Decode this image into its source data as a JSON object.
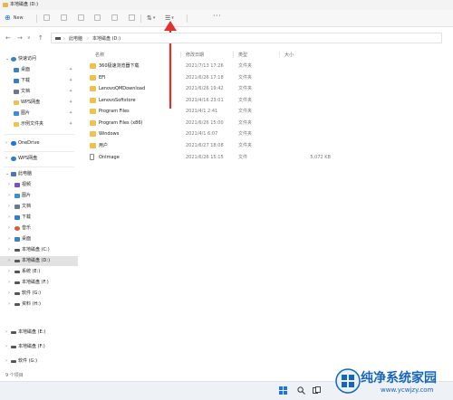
{
  "window": {
    "title": "本地磁盘 (D:)"
  },
  "toolbar": {
    "new_label": "New",
    "more_label": "···"
  },
  "address": {
    "segments": [
      "此电脑",
      "本地磁盘 (D:)"
    ]
  },
  "columns": {
    "name": "名称",
    "date": "修改日期",
    "type": "类型",
    "size": "大小"
  },
  "files": [
    {
      "name": "360极速浏览器下载",
      "date": "2021/7/13 17:26",
      "type": "文件夹",
      "size": "",
      "kind": "folder"
    },
    {
      "name": "EFI",
      "date": "2021/6/26 17:18",
      "type": "文件夹",
      "size": "",
      "kind": "folder"
    },
    {
      "name": "LenovoQMDownload",
      "date": "2021/6/26 19:42",
      "type": "文件夹",
      "size": "",
      "kind": "folder"
    },
    {
      "name": "LenovoSoftstore",
      "date": "2021/4/16 23:01",
      "type": "文件夹",
      "size": "",
      "kind": "folder"
    },
    {
      "name": "Program Files",
      "date": "2021/4/1 2:41",
      "type": "文件夹",
      "size": "",
      "kind": "folder"
    },
    {
      "name": "Program Files (x86)",
      "date": "2021/6/26 15:00",
      "type": "文件夹",
      "size": "",
      "kind": "folder"
    },
    {
      "name": "Windows",
      "date": "2021/4/1 6:07",
      "type": "文件夹",
      "size": "",
      "kind": "folder"
    },
    {
      "name": "用户",
      "date": "2021/6/27 18:08",
      "type": "文件夹",
      "size": "",
      "kind": "folder"
    },
    {
      "name": "OnImage",
      "date": "2021/6/26 15:15",
      "type": "文件",
      "size": "5,072 KB",
      "kind": "file"
    }
  ],
  "sidebar": {
    "quick_access": "快速访问",
    "quick_items": [
      {
        "label": "桌面",
        "icon": "desktop-icon",
        "color": "#3b82c4"
      },
      {
        "label": "下载",
        "icon": "download-icon",
        "color": "#2f7fd1"
      },
      {
        "label": "文档",
        "icon": "document-icon",
        "color": "#6a7a8c"
      },
      {
        "label": "WPS网盘",
        "icon": "wps-folder-icon",
        "color": "#f0c14b"
      },
      {
        "label": "图片",
        "icon": "pictures-icon",
        "color": "#3a8fd9"
      },
      {
        "label": "示例文件夹",
        "icon": "folder-icon",
        "color": "#f0c14b"
      }
    ],
    "onedrive": "OneDrive",
    "wps": "WPS网盘",
    "this_pc": "此电脑",
    "pc_items": [
      {
        "label": "视频",
        "icon": "videos-icon",
        "color": "#7a4fc4"
      },
      {
        "label": "图片",
        "icon": "pictures-icon",
        "color": "#3a8fd9"
      },
      {
        "label": "文档",
        "icon": "document-icon",
        "color": "#6a7a8c"
      },
      {
        "label": "下载",
        "icon": "download-icon",
        "color": "#2f7fd1"
      },
      {
        "label": "音乐",
        "icon": "music-icon",
        "color": "#e2563b"
      },
      {
        "label": "桌面",
        "icon": "desktop-icon",
        "color": "#3b82c4"
      },
      {
        "label": "本地磁盘 (C:)",
        "icon": "drive-icon",
        "color": "#555555"
      },
      {
        "label": "本地磁盘 (D:)",
        "icon": "drive-icon",
        "color": "#555555",
        "selected": true
      },
      {
        "label": "系统 (E:)",
        "icon": "drive-icon",
        "color": "#555555"
      },
      {
        "label": "本地磁盘 (F:)",
        "icon": "drive-icon",
        "color": "#555555"
      },
      {
        "label": "软件 (G:)",
        "icon": "drive-icon",
        "color": "#555555"
      },
      {
        "label": "资料 (H:)",
        "icon": "drive-icon",
        "color": "#555555"
      }
    ],
    "extra_items": [
      {
        "label": "本地磁盘 (E:)",
        "icon": "drive-icon",
        "color": "#555555"
      },
      {
        "label": "本地磁盘 (F:)",
        "icon": "drive-icon",
        "color": "#555555"
      },
      {
        "label": "软件 (G:)",
        "icon": "drive-icon",
        "color": "#555555"
      }
    ]
  },
  "status": {
    "count": "9 个项目"
  },
  "watermark": {
    "text": "纯净系统家园",
    "url": "www.ycwjzy.com"
  },
  "colors": {
    "accent": "#1a73e8",
    "annotation_arrow": "#e03030",
    "folder": "#f0c14b"
  }
}
